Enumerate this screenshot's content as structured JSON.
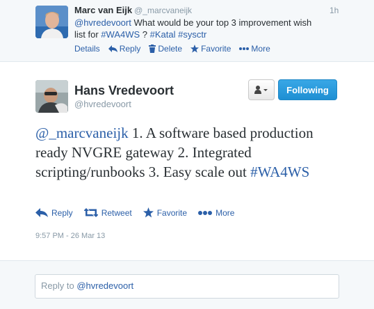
{
  "parent_tweet": {
    "name": "Marc van Eijk",
    "handle": "@_marcvaneijk",
    "time": "1h",
    "text_segments": [
      {
        "text": "@hvredevoort",
        "link": true
      },
      {
        "text": " What would be your top 3 improvement wish list for ",
        "link": false
      },
      {
        "text": "#WA4WS",
        "link": true
      },
      {
        "text": " ? ",
        "link": false
      },
      {
        "text": "#Katal",
        "link": true
      },
      {
        "text": " ",
        "link": false
      },
      {
        "text": "#sysctr",
        "link": true
      }
    ],
    "actions": {
      "details": "Details",
      "reply": "Reply",
      "delete": "Delete",
      "favorite": "Favorite",
      "more": "More"
    }
  },
  "main_tweet": {
    "name": "Hans Vredevoort",
    "handle": "@hvredevoort",
    "follow_label": "Following",
    "text_segments": [
      {
        "text": "@_marcvaneijk",
        "link": true
      },
      {
        "text": " 1. A software based production ready NVGRE gateway 2. Integrated scripting/runbooks 3. Easy scale out ",
        "link": false
      },
      {
        "text": "#WA4WS",
        "link": true
      }
    ],
    "actions": {
      "reply": "Reply",
      "retweet": "Retweet",
      "favorite": "Favorite",
      "more": "More"
    },
    "timestamp": "9:57 PM - 26 Mar 13"
  },
  "reply_box": {
    "prefix": "Reply to ",
    "mention": "@hvredevoort"
  },
  "colors": {
    "link": "#2b5fa8",
    "follow_button": "#2a9ee0",
    "muted": "#8899a6"
  }
}
